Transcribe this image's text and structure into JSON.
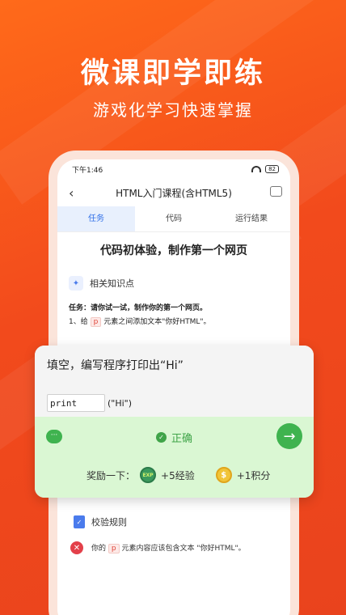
{
  "hero": {
    "title": "微课即学即练",
    "subtitle": "游戏化学习快速掌握"
  },
  "status": {
    "time": "下午1:46",
    "battery": "82"
  },
  "nav": {
    "title": "HTML入门课程(含HTML5)"
  },
  "tabs": [
    {
      "label": "任务",
      "active": true
    },
    {
      "label": "代码",
      "active": false
    },
    {
      "label": "运行结果",
      "active": false
    }
  ],
  "lesson": {
    "heading": "代码初体验，制作第一个网页",
    "knowledge_label": "相关知识点",
    "task_prefix": "任务：请你试一试，制作你的第一个网页。",
    "step1_pre": "1、给",
    "step1_tag": "p",
    "step1_post": "元素之间添加文本\"你好HTML\"。"
  },
  "check": {
    "title": "校验规则",
    "rule_pre": "你的",
    "rule_tag": "p",
    "rule_post": "元素内容应该包含文本 \"你好HTML\"。"
  },
  "quiz": {
    "question": "填空，编写程序打印出“Hi”",
    "input_value": "print",
    "suffix": "(\"Hi\")",
    "result": "正确",
    "reward_label": "奖励一下：",
    "exp_icon": "EXP",
    "exp_text": "+5经验",
    "coin_icon": "$",
    "coin_text": "+1积分"
  }
}
